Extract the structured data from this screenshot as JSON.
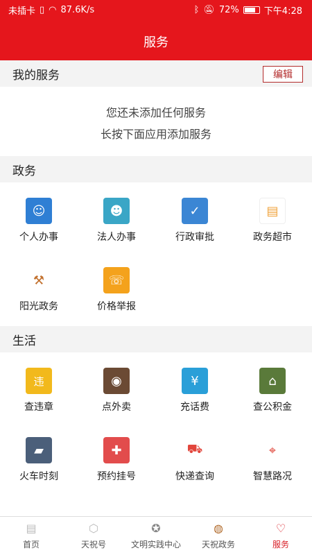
{
  "status_bar": {
    "carrier": "未插卡",
    "speed": "87.6K/s",
    "battery": "72%",
    "time": "下午4:28"
  },
  "header": {
    "title": "服务"
  },
  "my_services": {
    "heading": "我的服务",
    "edit_label": "编辑",
    "empty_line1": "您还未添加任何服务",
    "empty_line2": "长按下面应用添加服务"
  },
  "gov": {
    "heading": "政务",
    "items": [
      {
        "label": "个人办事",
        "icon": "person-card-icon",
        "color": "#2f7fd4"
      },
      {
        "label": "法人办事",
        "icon": "corporate-card-icon",
        "color": "#3aa6c6"
      },
      {
        "label": "行政审批",
        "icon": "calendar-check-icon",
        "color": "#3b86d4"
      },
      {
        "label": "政务超市",
        "icon": "document-icon",
        "color": "#f0a23a"
      },
      {
        "label": "阳光政务",
        "icon": "gavel-icon",
        "color": "#c2702d"
      },
      {
        "label": "价格举报",
        "icon": "price-phone-icon",
        "color": "#f4a21c"
      }
    ]
  },
  "life": {
    "heading": "生活",
    "items": [
      {
        "label": "查违章",
        "icon": "violation-icon",
        "color": "#f2b91c"
      },
      {
        "label": "点外卖",
        "icon": "food-icon",
        "color": "#6b4a34"
      },
      {
        "label": "充话费",
        "icon": "phone-recharge-icon",
        "color": "#2a9fd8"
      },
      {
        "label": "查公积金",
        "icon": "house-fund-icon",
        "color": "#5a7a3a"
      },
      {
        "label": "火车时刻",
        "icon": "train-icon",
        "color": "#4b5f7a"
      },
      {
        "label": "预约挂号",
        "icon": "medical-kit-icon",
        "color": "#e24c4c"
      },
      {
        "label": "快递查询",
        "icon": "delivery-truck-icon",
        "color": "#e2463c"
      },
      {
        "label": "智慧路况",
        "icon": "map-pin-icon",
        "color": "#e0483c"
      }
    ]
  },
  "bottom_nav": [
    {
      "label": "首页",
      "icon": "home-doc-icon",
      "active": false
    },
    {
      "label": "天祝号",
      "icon": "hexagon-icon",
      "active": false
    },
    {
      "label": "文明实践中心",
      "icon": "emblem-icon",
      "active": false
    },
    {
      "label": "天祝政务",
      "icon": "gov-logo-icon",
      "active": false
    },
    {
      "label": "服务",
      "icon": "heart-icon",
      "active": true
    }
  ]
}
